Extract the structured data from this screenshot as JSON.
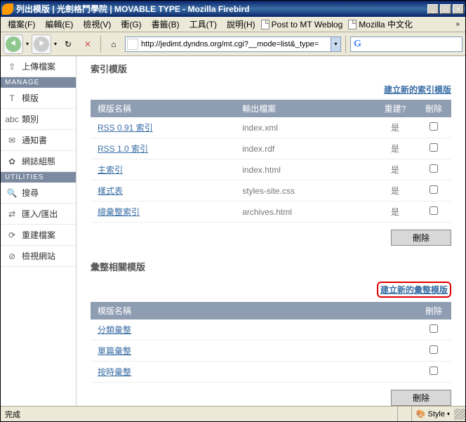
{
  "window": {
    "title": "列出模版 | 光劍格鬥學院 | MOVABLE TYPE - Mozilla Firebird"
  },
  "menu": {
    "file": "檔案(F)",
    "edit": "編輯(E)",
    "view": "檢視(V)",
    "go": "衝(G)",
    "bookmarks": "書籤(B)",
    "tools": "工具(T)",
    "help": "說明(H)",
    "link1": "Post to MT Weblog",
    "link2": "Mozilla 中文化"
  },
  "url": "http://jedimt.dyndns.org/mt.cgi?__mode=list&_type=",
  "sidebar": {
    "upload": "上傳檔案",
    "head_manage": "MANAGE",
    "templates": "模版",
    "categories": "類別",
    "notify": "通知書",
    "config": "網誌組態",
    "head_utilities": "UTILITIES",
    "search": "搜尋",
    "import": "匯入/匯出",
    "rebuild": "重建檔案",
    "view": "檢視網站"
  },
  "section1": {
    "title": "索引模版",
    "create": "建立新的索引模版",
    "headers": {
      "name": "模版名稱",
      "output": "輸出檔案",
      "rebuild": "重建?",
      "delete": "刪除"
    },
    "rows": [
      {
        "name": "RSS 0.91 索引",
        "file": "index.xml",
        "rebuild": "是"
      },
      {
        "name": "RSS 1.0 索引",
        "file": "index.rdf",
        "rebuild": "是"
      },
      {
        "name": "主索引",
        "file": "index.html",
        "rebuild": "是"
      },
      {
        "name": "樣式表",
        "file": "styles-site.css",
        "rebuild": "是"
      },
      {
        "name": "總彙整索引",
        "file": "archives.html",
        "rebuild": "是"
      }
    ],
    "delete_btn": "刪除"
  },
  "section2": {
    "title": "彙整相關模版",
    "create": "建立新的彙整模版",
    "headers": {
      "name": "模版名稱",
      "delete": "刪除"
    },
    "rows": [
      {
        "name": "分類彙整"
      },
      {
        "name": "單篇彙整"
      },
      {
        "name": "按時彙整"
      }
    ],
    "delete_btn": "刪除"
  },
  "status": {
    "done": "完成",
    "style": "Style"
  }
}
